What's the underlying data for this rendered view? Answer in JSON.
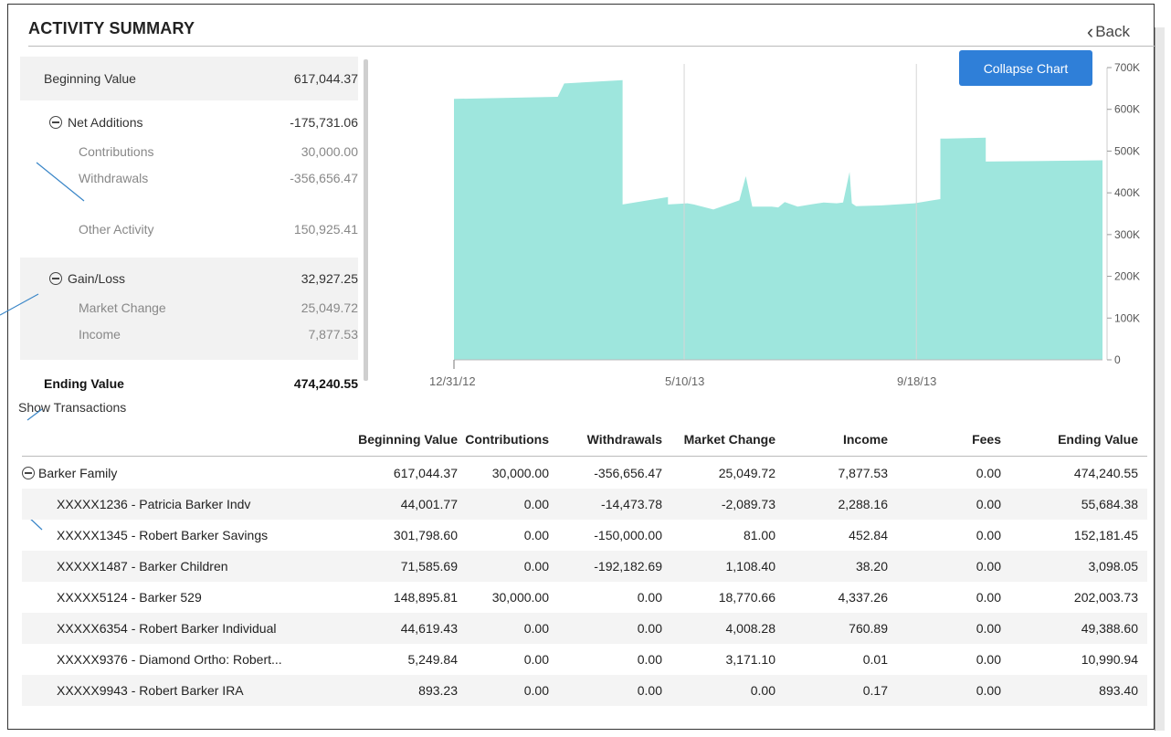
{
  "header": {
    "title": "ACTIVITY SUMMARY",
    "back_label": "Back"
  },
  "summary": {
    "beginning": {
      "label": "Beginning Value",
      "value": "617,044.37"
    },
    "net_additions": {
      "label": "Net Additions",
      "value": "-175,731.06"
    },
    "contributions": {
      "label": "Contributions",
      "value": "30,000.00"
    },
    "withdrawals": {
      "label": "Withdrawals",
      "value": "-356,656.47"
    },
    "other": {
      "label": "Other Activity",
      "value": "150,925.41"
    },
    "gain_loss": {
      "label": "Gain/Loss",
      "value": "32,927.25"
    },
    "market_change": {
      "label": "Market Change",
      "value": "25,049.72"
    },
    "income": {
      "label": "Income",
      "value": "7,877.53"
    },
    "ending": {
      "label": "Ending Value",
      "value": "474,240.55"
    }
  },
  "show_transactions_label": "Show Transactions",
  "collapse_chart_label": "Collapse Chart",
  "chart_data": {
    "type": "area",
    "color": "#9ee6dd",
    "x_tick_labels": [
      "12/31/12",
      "5/10/13",
      "9/18/13"
    ],
    "y_ticks": [
      "0",
      "100K",
      "200K",
      "300K",
      "400K",
      "500K",
      "600K",
      "700K"
    ],
    "ylim": [
      0,
      700000
    ],
    "x": [
      0,
      0.16,
      0.17,
      0.26,
      0.26,
      0.33,
      0.33,
      0.36,
      0.37,
      0.4,
      0.44,
      0.45,
      0.46,
      0.49,
      0.5,
      0.51,
      0.53,
      0.55,
      0.57,
      0.59,
      0.6,
      0.61,
      0.6135,
      0.62,
      0.66,
      0.71,
      0.75,
      0.75,
      0.76,
      0.82,
      0.82,
      1.0
    ],
    "values": [
      625000,
      630000,
      662000,
      670000,
      372000,
      390000,
      372000,
      375000,
      372000,
      360000,
      382000,
      440000,
      367000,
      367000,
      365000,
      378000,
      367000,
      372000,
      377000,
      375000,
      377000,
      450000,
      375000,
      368000,
      370000,
      375000,
      385000,
      530000,
      530000,
      532000,
      475000,
      478000
    ]
  },
  "table": {
    "headers": [
      "Beginning Value",
      "Contributions",
      "Withdrawals",
      "Market Change",
      "Income",
      "Fees",
      "Ending Value"
    ],
    "group": {
      "name": "Barker Family",
      "cells": [
        "617,044.37",
        "30,000.00",
        "-356,656.47",
        "25,049.72",
        "7,877.53",
        "0.00",
        "474,240.55"
      ]
    },
    "rows": [
      {
        "name": "XXXXX1236 - Patricia Barker Indv",
        "cells": [
          "44,001.77",
          "0.00",
          "-14,473.78",
          "-2,089.73",
          "2,288.16",
          "0.00",
          "55,684.38"
        ]
      },
      {
        "name": "XXXXX1345 - Robert Barker Savings",
        "cells": [
          "301,798.60",
          "0.00",
          "-150,000.00",
          "81.00",
          "452.84",
          "0.00",
          "152,181.45"
        ]
      },
      {
        "name": "XXXXX1487 - Barker Children",
        "cells": [
          "71,585.69",
          "0.00",
          "-192,182.69",
          "1,108.40",
          "38.20",
          "0.00",
          "3,098.05"
        ]
      },
      {
        "name": "XXXXX5124 - Barker 529",
        "cells": [
          "148,895.81",
          "30,000.00",
          "0.00",
          "18,770.66",
          "4,337.26",
          "0.00",
          "202,003.73"
        ]
      },
      {
        "name": "XXXXX6354 - Robert Barker Individual",
        "cells": [
          "44,619.43",
          "0.00",
          "0.00",
          "4,008.28",
          "760.89",
          "0.00",
          "49,388.60"
        ]
      },
      {
        "name": "XXXXX9376 - Diamond Ortho: Robert...",
        "cells": [
          "5,249.84",
          "0.00",
          "0.00",
          "3,171.10",
          "0.01",
          "0.00",
          "10,990.94"
        ]
      },
      {
        "name": "XXXXX9943 - Robert Barker IRA",
        "cells": [
          "893.23",
          "0.00",
          "0.00",
          "0.00",
          "0.17",
          "0.00",
          "893.40"
        ]
      }
    ]
  }
}
